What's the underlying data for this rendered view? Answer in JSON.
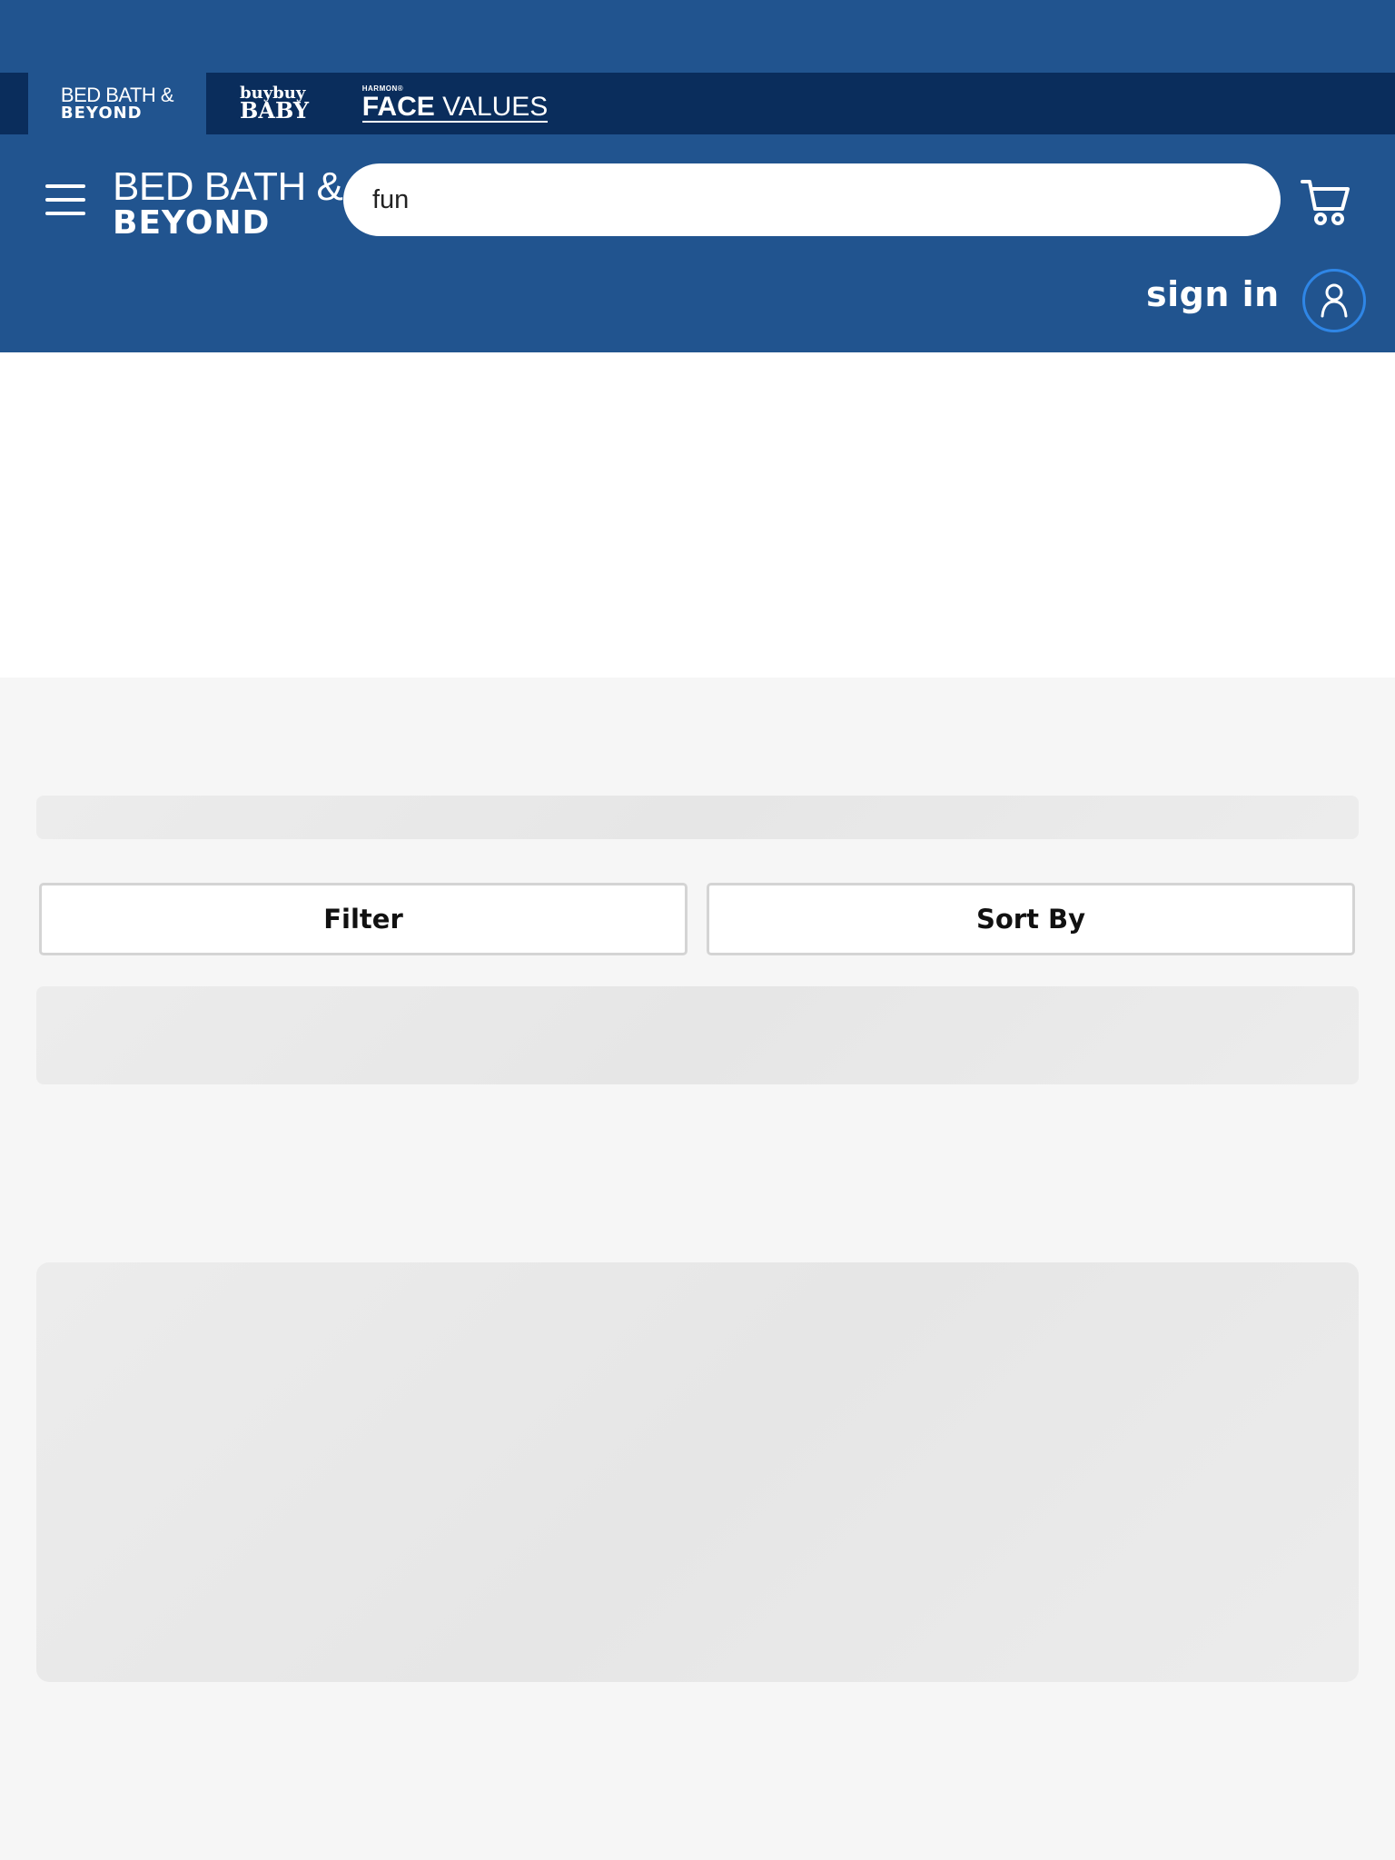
{
  "brands": {
    "tabs": [
      {
        "line1": "BED BATH &",
        "line2": "BEYOND",
        "active": true
      },
      {
        "line1": "buybuy",
        "line2": "BABY",
        "active": false
      },
      {
        "sup": "HARMON®",
        "bold": "FACE",
        "rest": " VALUES",
        "active": false
      }
    ]
  },
  "header": {
    "logo_line1": "BED BATH &",
    "logo_line2": "BEYOND",
    "search_value": "fun",
    "sign_in_label": "sign in",
    "icons": {
      "menu": "hamburger-menu-icon",
      "cart": "cart-icon",
      "account": "user-icon"
    }
  },
  "controls": {
    "filter_label": "Filter",
    "sort_label": "Sort By"
  },
  "colors": {
    "header_blue": "#21548f",
    "brand_bar_navy": "#0a2d5c",
    "account_ring": "#2f86e6",
    "page_bg": "#f6f6f6"
  }
}
